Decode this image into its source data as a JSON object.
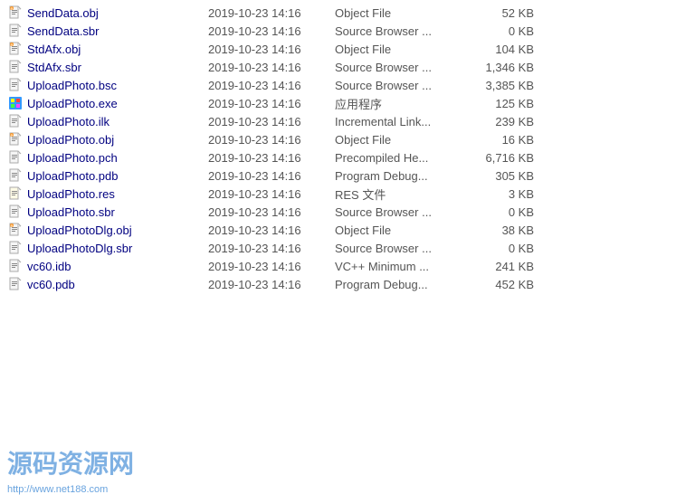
{
  "files": [
    {
      "name": "SendData.obj",
      "date": "2019-10-23 14:16",
      "type": "Object File",
      "size": "52 KB",
      "iconType": "obj"
    },
    {
      "name": "SendData.sbr",
      "date": "2019-10-23 14:16",
      "type": "Source Browser ...",
      "size": "0 KB",
      "iconType": "sbr"
    },
    {
      "name": "StdAfx.obj",
      "date": "2019-10-23 14:16",
      "type": "Object File",
      "size": "104 KB",
      "iconType": "obj"
    },
    {
      "name": "StdAfx.sbr",
      "date": "2019-10-23 14:16",
      "type": "Source Browser ...",
      "size": "1,346 KB",
      "iconType": "sbr"
    },
    {
      "name": "UploadPhoto.bsc",
      "date": "2019-10-23 14:16",
      "type": "Source Browser ...",
      "size": "3,385 KB",
      "iconType": "sbr"
    },
    {
      "name": "UploadPhoto.exe",
      "date": "2019-10-23 14:16",
      "type": "应用程序",
      "size": "125 KB",
      "iconType": "exe"
    },
    {
      "name": "UploadPhoto.ilk",
      "date": "2019-10-23 14:16",
      "type": "Incremental Link...",
      "size": "239 KB",
      "iconType": "sbr"
    },
    {
      "name": "UploadPhoto.obj",
      "date": "2019-10-23 14:16",
      "type": "Object File",
      "size": "16 KB",
      "iconType": "obj"
    },
    {
      "name": "UploadPhoto.pch",
      "date": "2019-10-23 14:16",
      "type": "Precompiled He...",
      "size": "6,716 KB",
      "iconType": "sbr"
    },
    {
      "name": "UploadPhoto.pdb",
      "date": "2019-10-23 14:16",
      "type": "Program Debug...",
      "size": "305 KB",
      "iconType": "sbr"
    },
    {
      "name": "UploadPhoto.res",
      "date": "2019-10-23 14:16",
      "type": "RES 文件",
      "size": "3 KB",
      "iconType": "res"
    },
    {
      "name": "UploadPhoto.sbr",
      "date": "2019-10-23 14:16",
      "type": "Source Browser ...",
      "size": "0 KB",
      "iconType": "sbr"
    },
    {
      "name": "UploadPhotoDlg.obj",
      "date": "2019-10-23 14:16",
      "type": "Object File",
      "size": "38 KB",
      "iconType": "obj"
    },
    {
      "name": "UploadPhotoDlg.sbr",
      "date": "2019-10-23 14:16",
      "type": "Source Browser ...",
      "size": "0 KB",
      "iconType": "sbr"
    },
    {
      "name": "vc60.idb",
      "date": "2019-10-23 14:16",
      "type": "VC++ Minimum ...",
      "size": "241 KB",
      "iconType": "sbr"
    },
    {
      "name": "vc60.pdb",
      "date": "2019-10-23 14:16",
      "type": "Program Debug...",
      "size": "452 KB",
      "iconType": "sbr"
    }
  ],
  "watermark": {
    "text": "源码资源网",
    "url": "http://www.net188.com"
  }
}
